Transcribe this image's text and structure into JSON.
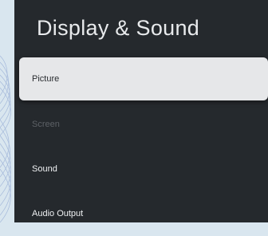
{
  "page": {
    "title": "Display & Sound"
  },
  "menu": {
    "items": [
      {
        "label": "Picture",
        "state": "selected"
      },
      {
        "label": "Screen",
        "state": "disabled"
      },
      {
        "label": "Sound",
        "state": "normal"
      },
      {
        "label": "Audio Output",
        "state": "normal"
      }
    ]
  },
  "colors": {
    "panel_bg": "#25292d",
    "selected_bg": "#e6e7e9",
    "disabled_text": "#5d6166",
    "backdrop": "#d9e6ef"
  }
}
